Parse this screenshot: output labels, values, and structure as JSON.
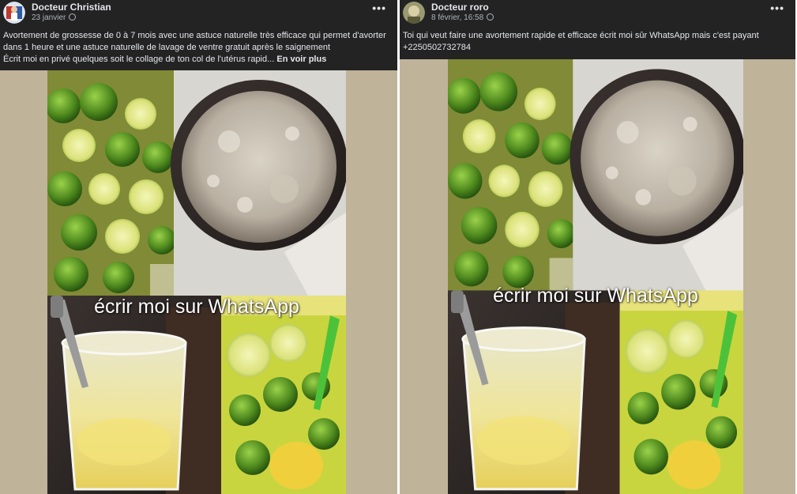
{
  "posts": [
    {
      "author": "Docteur Christian",
      "date": "23 janvier",
      "menu_icon": "more-horizontal-icon",
      "privacy_icon": "globe-icon",
      "text_lines": [
        "Avortement de grossesse de 0 à 7 mois avec une astuce naturelle très efficace qui permet d'avorter",
        "dans 1 heure et une astuce naturelle de lavage de ventre gratuit après le saignement",
        "Écrit moi en privé quelques soit le collage de ton col de l'utérus rapid..."
      ],
      "see_more": "En voir plus",
      "image_caption": "écrir moi sur WhatsApp"
    },
    {
      "author": "Docteur roro",
      "date": "8 février, 16:58",
      "menu_icon": "more-horizontal-icon",
      "privacy_icon": "globe-icon",
      "text_lines": [
        "Toi qui veut faire une avortement rapide et efficace écrit moi sûr WhatsApp mais c'est payant",
        "+2250502732784"
      ],
      "image_caption": "écrir moi sur WhatsApp"
    }
  ],
  "colors": {
    "header_bg": "#232324",
    "text": "#e4e6eb",
    "secondary_text": "#b0b3b8",
    "lime_green": "#5a8a1c",
    "lemon_yellow": "#d9d24a",
    "bowl_dark": "#2a2422"
  }
}
